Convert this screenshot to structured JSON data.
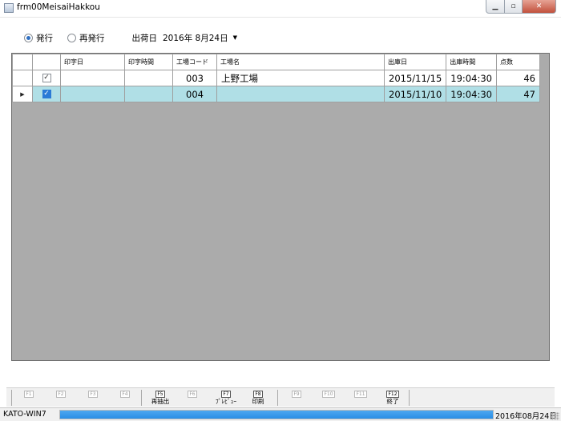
{
  "window": {
    "title": "frm00MeisaiHakkou",
    "icons": {
      "app": "form-icon",
      "min": "minimize-icon",
      "max": "maximize-icon",
      "close": "close-icon"
    }
  },
  "filter": {
    "issue_label": "発行",
    "reissue_label": "再発行",
    "issue_selected": true,
    "date_label": "出荷日",
    "date_value": "2016年 8月24日"
  },
  "grid": {
    "columns": [
      "",
      "印字日",
      "印字時間",
      "工場コード",
      "工場名",
      "出庫日",
      "出庫時間",
      "点数"
    ],
    "rows": [
      {
        "checked": true,
        "print_date": "",
        "print_time": "",
        "factory_code": "003",
        "factory_name": "上野工場",
        "out_date": "2015/11/15",
        "out_time": "19:04:30",
        "count": "46",
        "selected": false
      },
      {
        "checked": true,
        "print_date": "",
        "print_time": "",
        "factory_code": "004",
        "factory_name": "",
        "out_date": "2015/11/10",
        "out_time": "19:04:30",
        "count": "47",
        "selected": true
      }
    ],
    "colors": {
      "selected_row": "#b0dfe6",
      "empty_area": "#ababab"
    }
  },
  "function_keys": [
    {
      "key": "F1",
      "label": ""
    },
    {
      "key": "F2",
      "label": ""
    },
    {
      "key": "F3",
      "label": ""
    },
    {
      "key": "F4",
      "label": ""
    },
    {
      "key": "F5",
      "label": "再抽出"
    },
    {
      "key": "F6",
      "label": ""
    },
    {
      "key": "F7",
      "label": "ﾌﾟﾚﾋﾞｭｰ"
    },
    {
      "key": "F8",
      "label": "印刷"
    },
    {
      "key": "F9",
      "label": ""
    },
    {
      "key": "F10",
      "label": ""
    },
    {
      "key": "F11",
      "label": ""
    },
    {
      "key": "F12",
      "label": "終了"
    }
  ],
  "status": {
    "host": "KATO-WIN7",
    "date": "2016年08月24日",
    "progress": 1.0,
    "progress_color": "#2a8ee6"
  }
}
